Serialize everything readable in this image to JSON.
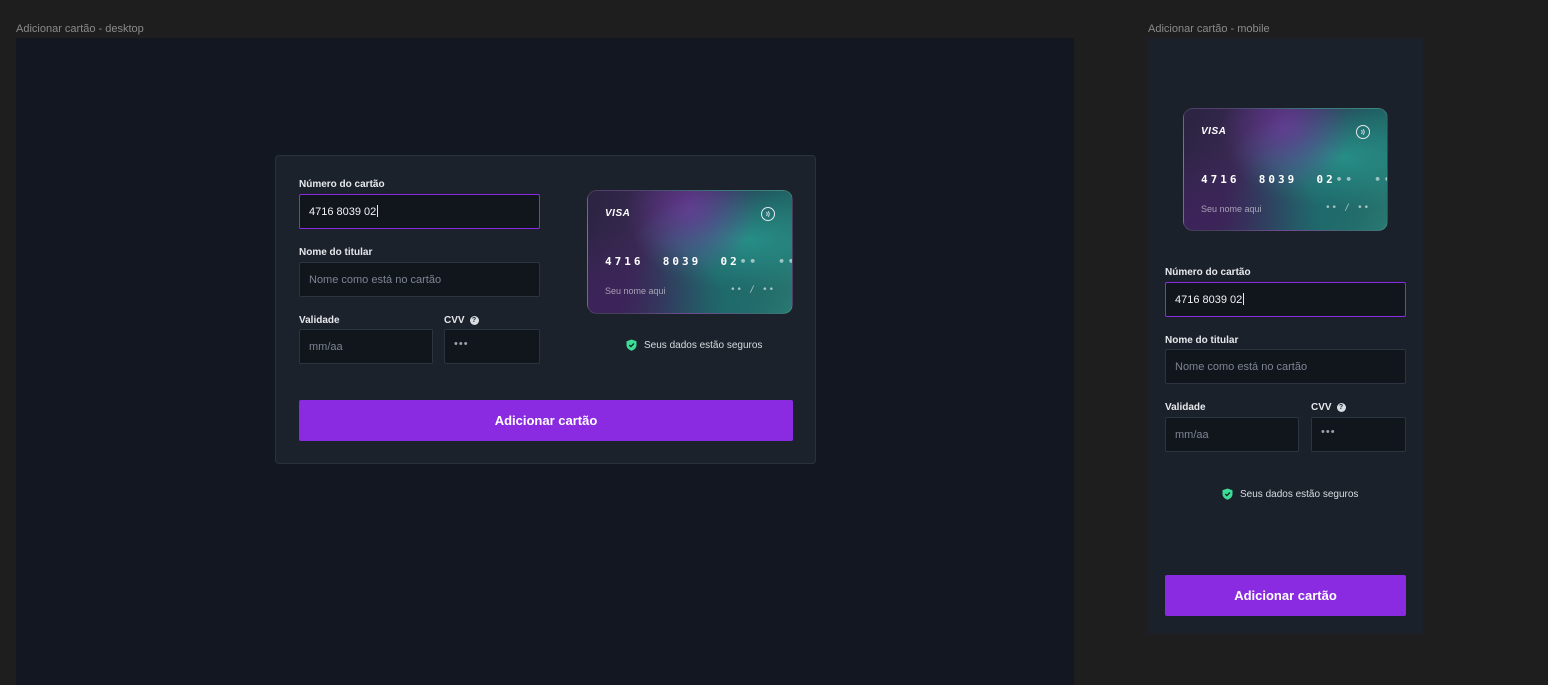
{
  "desktop": {
    "frame_label": "Adicionar cartão - desktop",
    "form": {
      "card_number_label": "Número do cartão",
      "card_number_value": "4716 8039 02",
      "holder_label": "Nome do titular",
      "holder_placeholder": "Nome como está no cartão",
      "expiry_label": "Validade",
      "expiry_placeholder": "mm/aa",
      "cvv_label": "CVV",
      "cvv_placeholder": "•••",
      "submit_label": "Adicionar cartão"
    },
    "card": {
      "brand": "VISA",
      "number_visible": "4716  8039  02",
      "number_masked": "••  ••••",
      "holder": "Seu nome aqui",
      "expiry": "•• / ••"
    },
    "secure_text": "Seus dados estão seguros"
  },
  "mobile": {
    "frame_label": "Adicionar cartão - mobile",
    "form": {
      "card_number_label": "Número do cartão",
      "card_number_value": "4716 8039 02",
      "holder_label": "Nome do titular",
      "holder_placeholder": "Nome como está no cartão",
      "expiry_label": "Validade",
      "expiry_placeholder": "mm/aa",
      "cvv_label": "CVV",
      "cvv_placeholder": "•••",
      "submit_label": "Adicionar cartão"
    },
    "card": {
      "brand": "VISA",
      "number_visible": "4716  8039  02",
      "number_masked": "••  ••••",
      "holder": "Seu nome aqui",
      "expiry": "•• / ••"
    },
    "secure_text": "Seus dados estão seguros"
  },
  "colors": {
    "accent": "#8A2BE2",
    "secure_icon": "#3ddc97",
    "canvas": "#1E1E1E"
  },
  "icons": [
    "help-icon",
    "shield-check-icon",
    "contactless-icon"
  ]
}
